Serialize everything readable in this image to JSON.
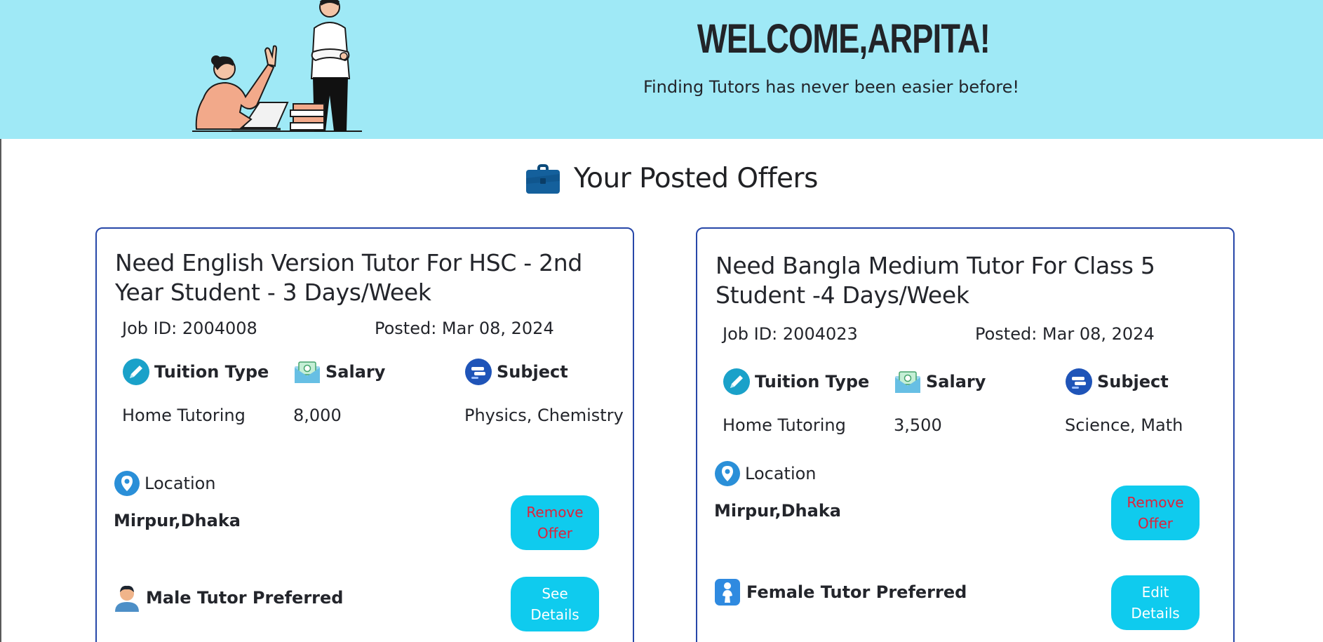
{
  "banner": {
    "title": "WELCOME,ARPITA!",
    "subtitle": "Finding Tutors has never been easier before!"
  },
  "section": {
    "title": "Your Posted Offers",
    "icon": "briefcase-icon"
  },
  "cards": [
    {
      "title": "Need English Version Tutor For HSC - 2nd Year Student - 3 Days/Week",
      "job_id": "Job ID: 2004008",
      "posted": "Posted: Mar 08, 2024",
      "tuition_type_label": "Tuition Type",
      "tuition_type_value": "Home Tutoring",
      "salary_label": "Salary",
      "salary_value": "8,000",
      "subject_label": "Subject",
      "subject_value": "Physics, Chemistry",
      "location_label": "Location",
      "location_value": "Mirpur,Dhaka",
      "preference": "Male Tutor Preferred",
      "primary_button": "Remove Offer",
      "secondary_button": "See Details"
    },
    {
      "title": "Need Bangla Medium Tutor For Class 5 Student -4 Days/Week",
      "job_id": "Job ID: 2004023",
      "posted": "Posted: Mar 08, 2024",
      "tuition_type_label": "Tuition Type",
      "tuition_type_value": "Home Tutoring",
      "salary_label": "Salary",
      "salary_value": "3,500",
      "subject_label": "Subject",
      "subject_value": "Science, Math",
      "location_label": "Location",
      "location_value": "Mirpur,Dhaka",
      "preference": "Female Tutor Preferred",
      "primary_button": "Remove Offer",
      "secondary_button": "Edit Details"
    }
  ],
  "colors": {
    "banner_bg": "#9fe9f6",
    "card_border": "#2747a8",
    "button_bg": "#0fcbee",
    "remove_text": "#e0213a"
  }
}
